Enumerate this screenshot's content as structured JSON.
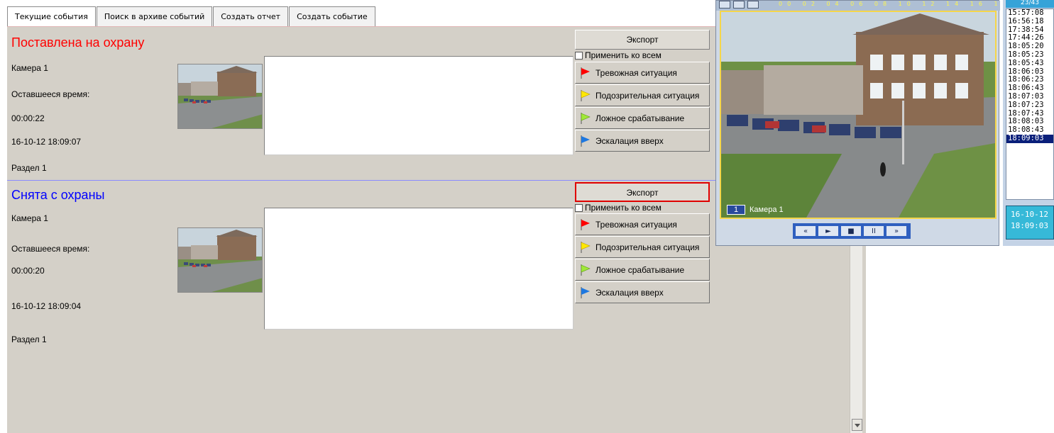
{
  "tabs": [
    {
      "label": "Текущие события",
      "active": true
    },
    {
      "label": "Поиск в архиве событий",
      "active": false
    },
    {
      "label": "Создать отчет",
      "active": false
    },
    {
      "label": "Создать событие",
      "active": false
    }
  ],
  "events": [
    {
      "title": "Поставлена на охрану",
      "title_color": "#ff0000",
      "camera": "Камера 1",
      "remaining_label": "Оставшееся время:",
      "remaining": "00:00:22",
      "datetime": "16-10-12 18:09:07",
      "section": "Раздел 1",
      "export_label": "Экспорт",
      "apply_all_label": "Применить ко всем",
      "buttons": [
        {
          "label": "Тревожная ситуация",
          "flag_color": "#ff0000"
        },
        {
          "label": "Подозрительная ситуация",
          "flag_color": "#ffe800"
        },
        {
          "label": "Ложное срабатывание",
          "flag_color": "#a0e838"
        },
        {
          "label": "Эскалация вверх",
          "flag_color": "#1e78e0"
        }
      ]
    },
    {
      "title": "Снята с охраны",
      "title_color": "#0000ff",
      "camera": "Камера 1",
      "remaining_label": "Оставшееся время:",
      "remaining": "00:00:20",
      "datetime": "16-10-12 18:09:04",
      "section": "Раздел 1",
      "export_label": "Экспорт",
      "apply_all_label": "Применить ко всем",
      "buttons": [
        {
          "label": "Тревожная ситуация",
          "flag_color": "#ff0000"
        },
        {
          "label": "Подозрительная ситуация",
          "flag_color": "#ffe800"
        },
        {
          "label": "Ложное срабатывание",
          "flag_color": "#a0e838"
        },
        {
          "label": "Эскалация вверх",
          "flag_color": "#1e78e0"
        }
      ]
    }
  ],
  "video": {
    "timeline_hours": "00 02 04 06 08 10 12 14 16 18 20 22 24",
    "camera_number": "1",
    "camera_name": "Камера 1",
    "controls": [
      "«",
      "►",
      "■",
      "II",
      "»"
    ]
  },
  "timestamps": {
    "count": "23/43",
    "items": [
      "15:57:08",
      "16:56:18",
      "17:38:54",
      "17:44:26",
      "18:05:20",
      "18:05:23",
      "18:05:43",
      "18:06:03",
      "18:06:23",
      "18:06:43",
      "18:07:03",
      "18:07:23",
      "18:07:43",
      "18:08:03",
      "18:08:43",
      "18:09:03"
    ],
    "selected": "18:09:03",
    "date_line1": "16-10-12",
    "date_line2": "18:09:03"
  }
}
